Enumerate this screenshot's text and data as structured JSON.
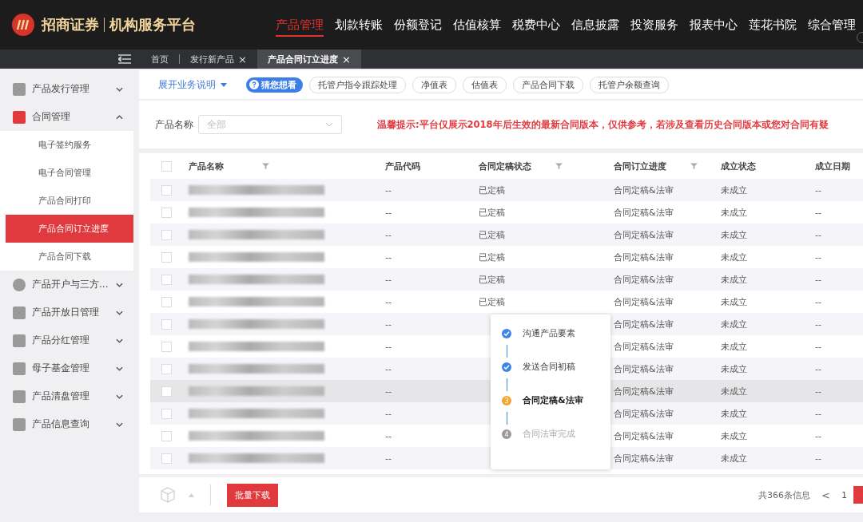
{
  "header": {
    "logo_text": "招商证券",
    "platform": "机构服务平台",
    "nav": [
      {
        "label": "产品管理",
        "selected": true
      },
      {
        "label": "划款转账",
        "selected": false
      },
      {
        "label": "份额登记",
        "selected": false
      },
      {
        "label": "估值核算",
        "selected": false
      },
      {
        "label": "税费中心",
        "selected": false
      },
      {
        "label": "信息披露",
        "selected": false
      },
      {
        "label": "投资服务",
        "selected": false
      },
      {
        "label": "报表中心",
        "selected": false
      },
      {
        "label": "莲花书院",
        "selected": false
      },
      {
        "label": "综合管理",
        "selected": false
      }
    ]
  },
  "tabs": [
    {
      "label": "首页",
      "selected": false
    },
    {
      "label": "发行新产品",
      "close": "×",
      "selected": false
    },
    {
      "label": "产品合同订立进度",
      "close": "×",
      "selected": true
    }
  ],
  "sidebar": {
    "items": [
      {
        "label": "产品发行管理",
        "expanded": false
      },
      {
        "label": "合同管理",
        "expanded": true,
        "children": [
          {
            "label": "电子签约服务",
            "selected": false
          },
          {
            "label": "电子合同管理",
            "selected": false
          },
          {
            "label": "产品合同打印",
            "selected": false
          },
          {
            "label": "产品合同订立进度",
            "selected": true
          },
          {
            "label": "产品合同下载",
            "selected": false
          }
        ]
      },
      {
        "label": "产品开户与三方...",
        "expanded": false
      },
      {
        "label": "产品开放日管理",
        "expanded": false
      },
      {
        "label": "产品分红管理",
        "expanded": false
      },
      {
        "label": "母子基金管理",
        "expanded": false
      },
      {
        "label": "产品清盘管理",
        "expanded": false
      },
      {
        "label": "产品信息查询",
        "expanded": false
      }
    ]
  },
  "toolbar": {
    "expand_link": "展开业务说明",
    "suggest_badge": "猜您想看",
    "chips": [
      "托管户指令跟踪处理",
      "净值表",
      "估值表",
      "产品合同下载",
      "托管户余额查询"
    ]
  },
  "filter": {
    "label": "产品名称",
    "placeholder": "全部",
    "notice": "温馨提示:平台仅展示2018年后生效的最新合同版本，仅供参考，若涉及查看历史合同版本或您对合同有疑"
  },
  "table": {
    "all_checked": false,
    "columns": [
      {
        "label": "产品名称",
        "filter": true
      },
      {
        "label": "产品代码",
        "filter": false
      },
      {
        "label": "合同定稿状态",
        "filter": true
      },
      {
        "label": "合同订立进度",
        "filter": true
      },
      {
        "label": "成立状态",
        "filter": false
      },
      {
        "label": "成立日期",
        "filter": false
      }
    ],
    "rows": [
      {
        "checked": false,
        "name_blurred": true,
        "code": "--",
        "status": "已定稿",
        "progress": "合同定稿&法审",
        "established": "未成立",
        "date": "--",
        "hovered": false
      },
      {
        "checked": false,
        "name_blurred": true,
        "code": "--",
        "status": "已定稿",
        "progress": "合同定稿&法审",
        "established": "未成立",
        "date": "--",
        "hovered": false
      },
      {
        "checked": false,
        "name_blurred": true,
        "code": "--",
        "status": "已定稿",
        "progress": "合同定稿&法审",
        "established": "未成立",
        "date": "--",
        "hovered": false
      },
      {
        "checked": false,
        "name_blurred": true,
        "code": "--",
        "status": "已定稿",
        "progress": "合同定稿&法审",
        "established": "未成立",
        "date": "--",
        "hovered": false
      },
      {
        "checked": false,
        "name_blurred": true,
        "code": "--",
        "status": "已定稿",
        "progress": "合同定稿&法审",
        "established": "未成立",
        "date": "--",
        "hovered": false
      },
      {
        "checked": false,
        "name_blurred": true,
        "code": "--",
        "status": "已定稿",
        "progress": "合同定稿&法审",
        "established": "未成立",
        "date": "--",
        "hovered": false
      },
      {
        "checked": false,
        "name_blurred": true,
        "code": "--",
        "progress": "合同定稿&法审",
        "established": "未成立",
        "date": "--",
        "hovered": false
      },
      {
        "checked": false,
        "name_blurred": true,
        "code": "--",
        "progress": "合同定稿&法审",
        "established": "未成立",
        "date": "--",
        "hovered": false
      },
      {
        "checked": false,
        "name_blurred": true,
        "code": "--",
        "progress": "合同定稿&法审",
        "established": "未成立",
        "date": "--",
        "hovered": false
      },
      {
        "checked": false,
        "name_blurred": true,
        "code": "--",
        "progress": "合同定稿&法审",
        "established": "未成立",
        "date": "--",
        "hovered": true
      },
      {
        "checked": false,
        "name_blurred": true,
        "code": "--",
        "progress": "合同定稿&法审",
        "established": "未成立",
        "date": "--",
        "hovered": false
      },
      {
        "checked": false,
        "name_blurred": true,
        "code": "--",
        "progress": "合同定稿&法审",
        "established": "未成立",
        "date": "--",
        "hovered": false
      },
      {
        "checked": false,
        "name_blurred": true,
        "code": "--",
        "progress": "合同定稿&法审",
        "established": "未成立",
        "date": "--",
        "hovered": false
      }
    ]
  },
  "progress_popover": {
    "steps": [
      {
        "label": "沟通产品要素",
        "kind": "done"
      },
      {
        "label": "发送合同初稿",
        "kind": "done"
      },
      {
        "number": "3",
        "label": "合同定稿&法审",
        "kind": "current"
      },
      {
        "number": "4",
        "label": "合同法审完成",
        "kind": "pending"
      }
    ]
  },
  "footer": {
    "batch_button": "批量下载",
    "total": "共366条信息",
    "prev": "<",
    "pages": [
      {
        "label": "1",
        "selected": false
      },
      {
        "selected": true
      }
    ]
  }
}
